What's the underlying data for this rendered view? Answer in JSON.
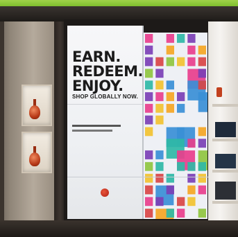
{
  "photo": {
    "description_hidden": "",
    "headline": [
      "EARN.",
      "REDEEM.",
      "ENJOY."
    ],
    "tagline": "SHOP GLOBALLY NOW.",
    "tile_colors": [
      "#e83e8c",
      "#f5a623",
      "#3a8fd6",
      "#2fb8a6",
      "#8fc63f",
      "#7b3fb5",
      "#f2c230",
      "#d94545"
    ]
  }
}
